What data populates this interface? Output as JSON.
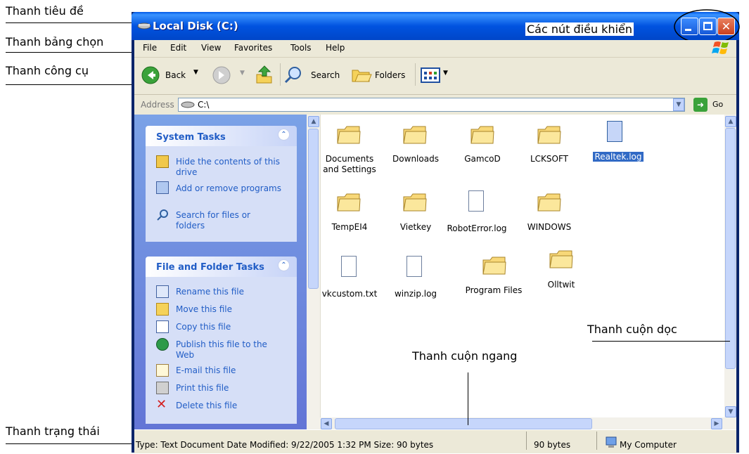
{
  "annotations": {
    "title_bar": "Thanh tiêu đề",
    "menu_bar": "Thanh bảng chọn",
    "toolbar": "Thanh công cụ",
    "control_buttons": "Các nút điều khiển",
    "vertical_scroll": "Thanh cuộn dọc",
    "horizontal_scroll": "Thanh cuộn ngang",
    "status_bar": "Thanh trạng thái"
  },
  "window": {
    "title": "Local Disk (C:)"
  },
  "menu": [
    "File",
    "Edit",
    "View",
    "Favorites",
    "Tools",
    "Help"
  ],
  "toolbar": {
    "back": "Back",
    "search": "Search",
    "folders": "Folders"
  },
  "address": {
    "label": "Address",
    "value": "C:\\",
    "go": "Go"
  },
  "system_tasks": {
    "title": "System Tasks",
    "items": [
      "Hide the contents of this drive",
      "Add or remove programs",
      "Search for files or folders"
    ]
  },
  "file_tasks": {
    "title": "File and Folder Tasks",
    "items": [
      "Rename this file",
      "Move this file",
      "Copy this file",
      "Publish this file to the Web",
      "E-mail this file",
      "Print this file",
      "Delete this file"
    ]
  },
  "files": [
    {
      "name": "Documents and Settings",
      "type": "folder"
    },
    {
      "name": "Downloads",
      "type": "folder"
    },
    {
      "name": "GamcoD",
      "type": "folder"
    },
    {
      "name": "LCKSOFT",
      "type": "folder"
    },
    {
      "name": "Realtek.log",
      "type": "doc",
      "selected": true
    },
    {
      "name": "TempEI4",
      "type": "folder"
    },
    {
      "name": "Vietkey",
      "type": "folder"
    },
    {
      "name": "RobotError.log",
      "type": "doc"
    },
    {
      "name": "WINDOWS",
      "type": "folder"
    },
    {
      "name": "vkcustom.txt",
      "type": "doc"
    },
    {
      "name": "winzip.log",
      "type": "doc"
    },
    {
      "name": "Program Files",
      "type": "folder"
    },
    {
      "name": "Olltwit",
      "type": "folder"
    }
  ],
  "status": {
    "info": "Type: Text Document Date Modified: 9/22/2005 1:32 PM Size: 90 bytes",
    "size": "90 bytes",
    "location": "My Computer"
  },
  "colors": {
    "title_blue": "#0053e0",
    "task_link": "#215dc6",
    "selection": "#316ac5"
  }
}
